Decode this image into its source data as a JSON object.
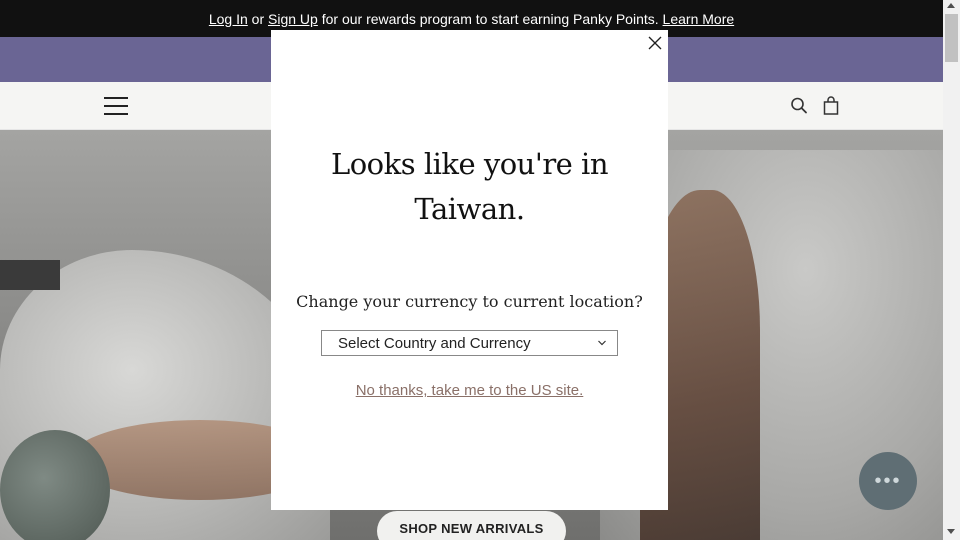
{
  "announcement": {
    "login": "Log In",
    "or": " or ",
    "signup": "Sign Up",
    "message": " for our rewards program to start earning Panky Points. ",
    "learn_more": "Learn More"
  },
  "header": {
    "menu_icon": "hamburger-menu-icon",
    "search_icon": "search-icon",
    "cart_icon": "shopping-bag-icon"
  },
  "hero": {
    "cta_label": "SHOP NEW ARRIVALS"
  },
  "modal": {
    "title_line1": "Looks like you're in",
    "title_line2": "Taiwan.",
    "subtitle": "Change your currency to current location?",
    "select_value": "Select Country and Currency",
    "decline_link": "No thanks, take me to the US site.",
    "close_icon": "close-icon"
  },
  "chat": {
    "icon": "chat-bubble-icon"
  },
  "colors": {
    "announcement_bg": "#111111",
    "promo_bg": "#6a6594",
    "header_bg": "#f5f5f3",
    "link_color": "#8a7068"
  }
}
